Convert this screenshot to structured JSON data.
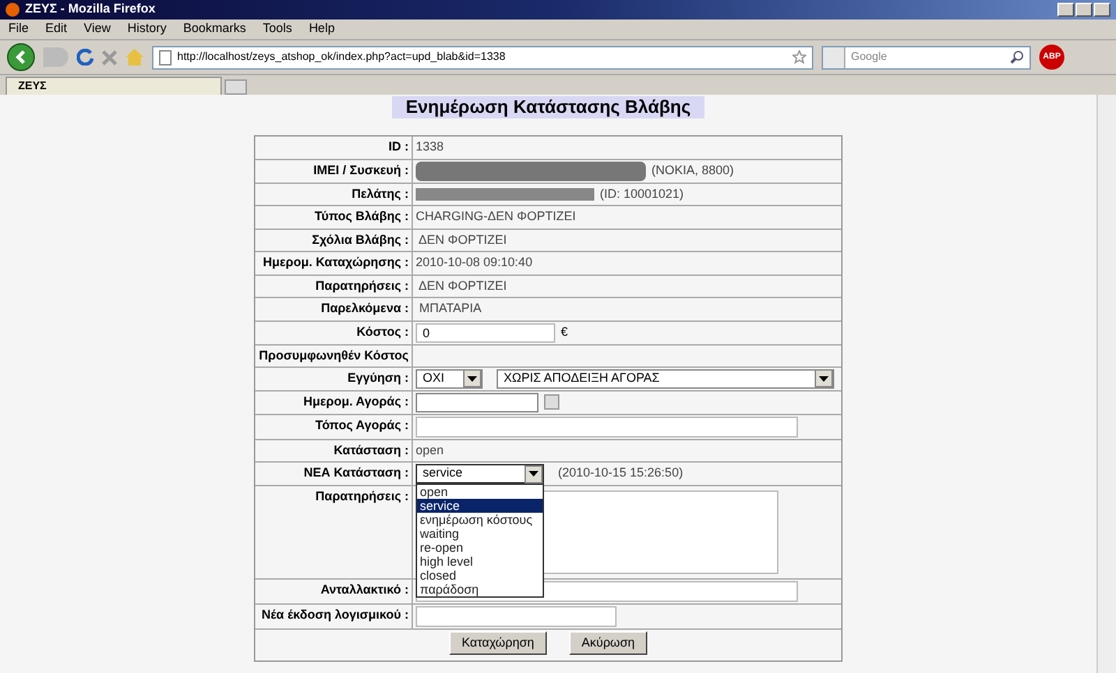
{
  "window": {
    "title": "ΖΕΥΣ - Mozilla Firefox"
  },
  "menu": [
    "File",
    "Edit",
    "View",
    "History",
    "Bookmarks",
    "Tools",
    "Help"
  ],
  "address": {
    "value": "http://localhost/zeys_atshop_ok/index.php?act=upd_blab&id=1338"
  },
  "search": {
    "placeholder": "Google"
  },
  "addon_badge": "ABP",
  "tabs": [
    {
      "label": "ΖΕΥΣ",
      "selected": true
    }
  ],
  "page_title": "Ενημέρωση Κατάστασης Βλάβης",
  "form": {
    "rows": [
      {
        "label": "ID :",
        "kind": "text",
        "value": "1338"
      },
      {
        "label": "IMEI / Συσκευή :",
        "kind": "redacted",
        "value": "(NOKIA, 8800)"
      },
      {
        "label": "Πελάτης :",
        "kind": "redacted",
        "value": "(ID: 10001021)"
      },
      {
        "label": "Τύπος Βλάβης :",
        "kind": "text",
        "value": "CHARGING-ΔΕΝ ΦΟΡΤΙΖΕΙ"
      },
      {
        "label": "Σχόλια Βλάβης :",
        "kind": "text",
        "value": " ΔΕΝ ΦΟΡΤΙΖΕΙ"
      },
      {
        "label": "Ημερομ. Καταχώρησης :",
        "kind": "text",
        "value": "2010-10-08 09:10:40"
      },
      {
        "label": "Παρατηρήσεις :",
        "kind": "text",
        "value": " ΔΕΝ ΦΟΡΤΙΖΕΙ"
      },
      {
        "label": "Παρελκόμενα :",
        "kind": "text",
        "value": " ΜΠΑΤΑΡΙΑ"
      },
      {
        "label": "Κόστος :",
        "kind": "input",
        "value": "0",
        "suffix": "€"
      },
      {
        "label": "Προσυμφωνηθέν Κόστος",
        "kind": "empty"
      },
      {
        "label": "Εγγύηση :",
        "kind": "selects",
        "value": "ΟΧΙ",
        "value2": "ΧΩΡΙΣ ΑΠΟΔΕΙΞΗ ΑΓΟΡΑΣ"
      },
      {
        "label": "Ημερομ. Αγοράς :",
        "kind": "date"
      },
      {
        "label": "Τόπος Αγοράς :",
        "kind": "wide"
      },
      {
        "label": "Κατάσταση :",
        "kind": "text",
        "value": "open"
      },
      {
        "label": "ΝΕΑ Κατάσταση :",
        "kind": "status",
        "value": "service",
        "suffix": "(2010-10-15 15:26:50)",
        "options": [
          {
            "label": "open",
            "selected": false
          },
          {
            "label": "service",
            "selected": true
          },
          {
            "label": "ενημέρωση κόστους",
            "selected": false
          },
          {
            "label": "waiting",
            "selected": false
          },
          {
            "label": "re-open",
            "selected": false
          },
          {
            "label": "high level",
            "selected": false
          },
          {
            "label": "closed",
            "selected": false
          },
          {
            "label": "παράδοση",
            "selected": false
          }
        ]
      },
      {
        "label": "Παρατηρήσεις :",
        "kind": "textarea"
      },
      {
        "label": "Ανταλλακτικό :",
        "kind": "wide"
      },
      {
        "label": "Νέα έκδοση λογισμικού :",
        "kind": "medium"
      }
    ],
    "buttons": [
      "Καταχώρηση",
      "Ακύρωση"
    ]
  }
}
